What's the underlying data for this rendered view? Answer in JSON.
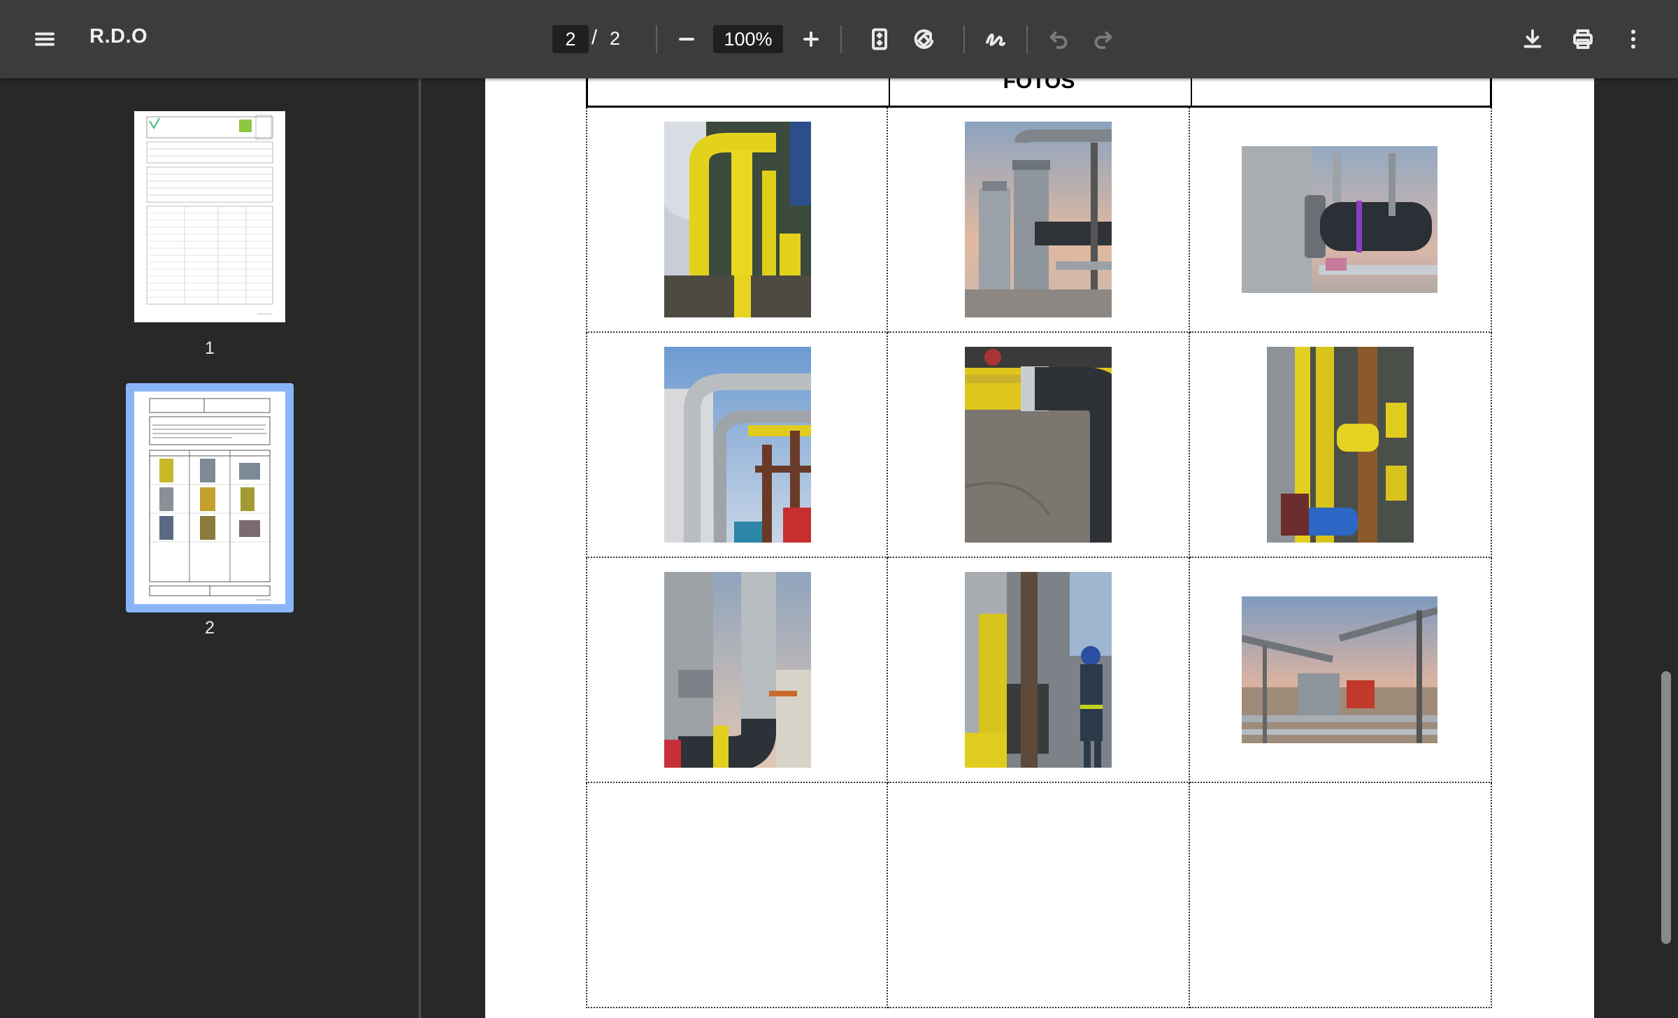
{
  "toolbar": {
    "title": "R.D.O",
    "current_page": "2",
    "page_separator": "/",
    "total_pages": "2",
    "zoom": "100%",
    "icons": [
      "menu-icon",
      "zoom-out-icon",
      "zoom-in-icon",
      "fit-page-icon",
      "rotate-icon",
      "annotate-icon",
      "undo-icon",
      "redo-icon",
      "download-icon",
      "print-icon",
      "more-icon"
    ]
  },
  "sidebar": {
    "thumbnails": [
      {
        "label": "1",
        "selected": false
      },
      {
        "label": "2",
        "selected": true
      }
    ]
  },
  "document": {
    "table_header": "FOTOS",
    "photos": [
      {
        "description": "yellow-pipes-vertical",
        "orientation": "portrait"
      },
      {
        "description": "grey-silencer-tower",
        "orientation": "portrait"
      },
      {
        "description": "tank-flange-black-pipe",
        "orientation": "landscape"
      },
      {
        "description": "grey-pipes-steel-frame",
        "orientation": "portrait"
      },
      {
        "description": "yellow-pipe-weld-black-elbow",
        "orientation": "portrait"
      },
      {
        "description": "yellow-pipes-blue-valve",
        "orientation": "portrait"
      },
      {
        "description": "grey-pipe-black-elbow-lift",
        "orientation": "portrait"
      },
      {
        "description": "worker-yellow-valves",
        "orientation": "portrait"
      },
      {
        "description": "pipe-rack-sunset",
        "orientation": "landscape"
      }
    ]
  },
  "colors": {
    "toolbar_bg": "#3c3c3c",
    "sidebar_bg": "#282828",
    "selection": "#8ab4f8",
    "pipe_yellow": "#e8d61a",
    "pipe_grey": "#9aa0a6"
  }
}
